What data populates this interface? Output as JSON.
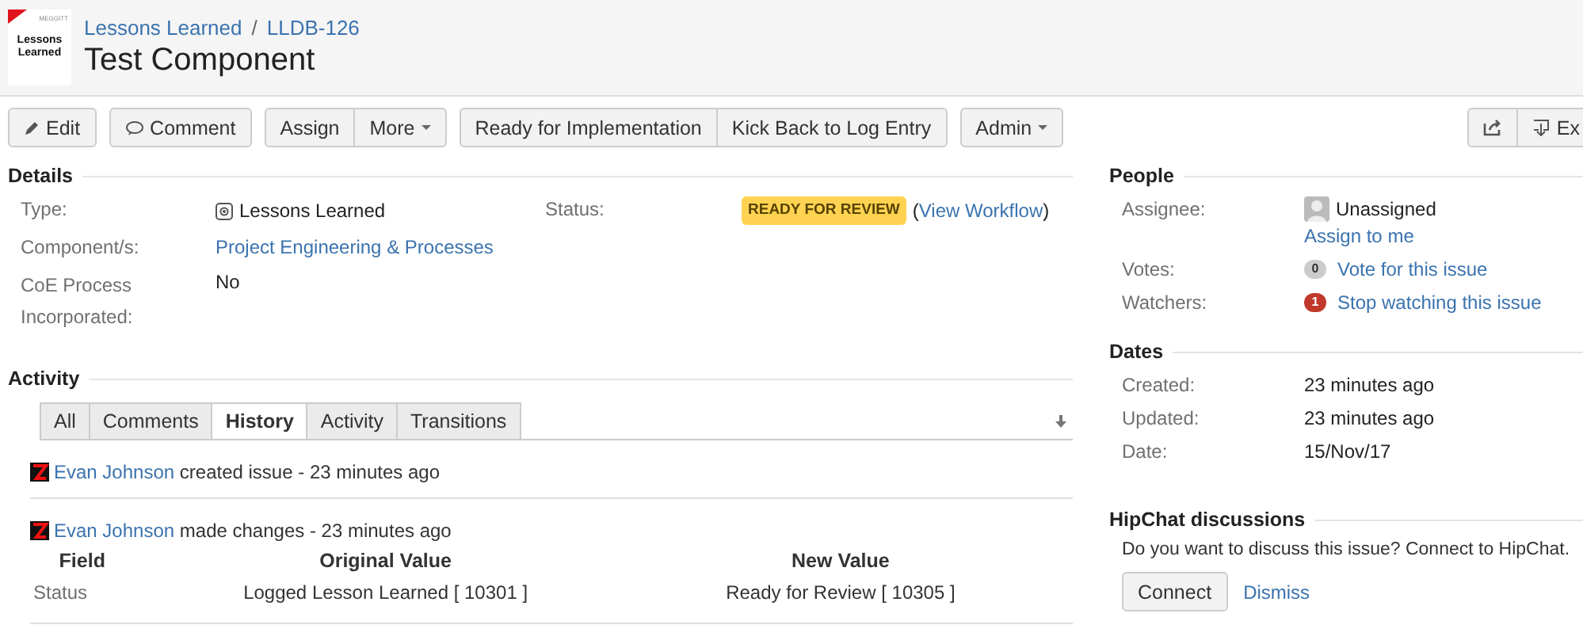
{
  "logo": {
    "brand": "MEGGITT",
    "lines": [
      "Lessons",
      "Learned"
    ]
  },
  "breadcrumbs": [
    "Lessons Learned",
    "LLDB-126"
  ],
  "breadcrumb_separator": "/",
  "title": "Test Component",
  "toolbar": [
    [
      {
        "label": "Edit",
        "kind": "edit"
      }
    ],
    [
      {
        "label": "Comment",
        "kind": "comment"
      }
    ],
    [
      {
        "label": "Assign"
      },
      {
        "label": "More",
        "caret": true
      }
    ],
    [
      {
        "label": "Ready for Implementation"
      },
      {
        "label": "Kick Back to Log Entry"
      }
    ],
    [
      {
        "label": "Admin",
        "caret": true
      }
    ]
  ],
  "toolbar_right": [
    {
      "kind": "share"
    },
    {
      "label": "Ex",
      "kind": "export"
    }
  ],
  "details": {
    "heading": "Details",
    "type_label": "Type:",
    "type_value": "Lessons Learned",
    "status_label": "Status:",
    "status": "READY FOR REVIEW",
    "workflow_open": "(",
    "workflow_link": "View Workflow",
    "workflow_close": ")",
    "component_label": "Component/s:",
    "component_value": "Project Engineering & Processes",
    "coe_label": "CoE Process Incorporated:",
    "coe_value": "No"
  },
  "activity": {
    "heading": "Activity",
    "tabs": [
      {
        "label": "All",
        "selected": false
      },
      {
        "label": "Comments",
        "selected": false
      },
      {
        "label": "History",
        "selected": true
      },
      {
        "label": "Activity",
        "selected": false
      },
      {
        "label": "Transitions",
        "selected": false
      }
    ],
    "entries": [
      {
        "user": "Evan Johnson",
        "action": "created issue - 23 minutes ago"
      },
      {
        "user": "Evan Johnson",
        "action": "made changes - 23 minutes ago",
        "columns": [
          "Field",
          "Original Value",
          "New Value"
        ],
        "rows": [
          [
            "Status",
            "Logged Lesson Learned [ 10301 ]",
            "Ready for Review [ 10305 ]"
          ]
        ]
      }
    ]
  },
  "people": {
    "heading": "People",
    "assignee_label": "Assignee:",
    "assignee": "Unassigned",
    "assign_link": "Assign to me",
    "votes_label": "Votes:",
    "votes_count": "0",
    "votes_link": "Vote for this issue",
    "watchers_label": "Watchers:",
    "watchers_count": "1",
    "watchers_link": "Stop watching this issue"
  },
  "dates": {
    "heading": "Dates",
    "rows": [
      [
        "Created:",
        "23 minutes ago"
      ],
      [
        "Updated:",
        "23 minutes ago"
      ],
      [
        "Date:",
        "15/Nov/17"
      ]
    ]
  },
  "hipchat": {
    "heading": "HipChat discussions",
    "text": "Do you want to discuss this issue? Connect to HipChat.",
    "connect": "Connect",
    "dismiss": "Dismiss"
  }
}
